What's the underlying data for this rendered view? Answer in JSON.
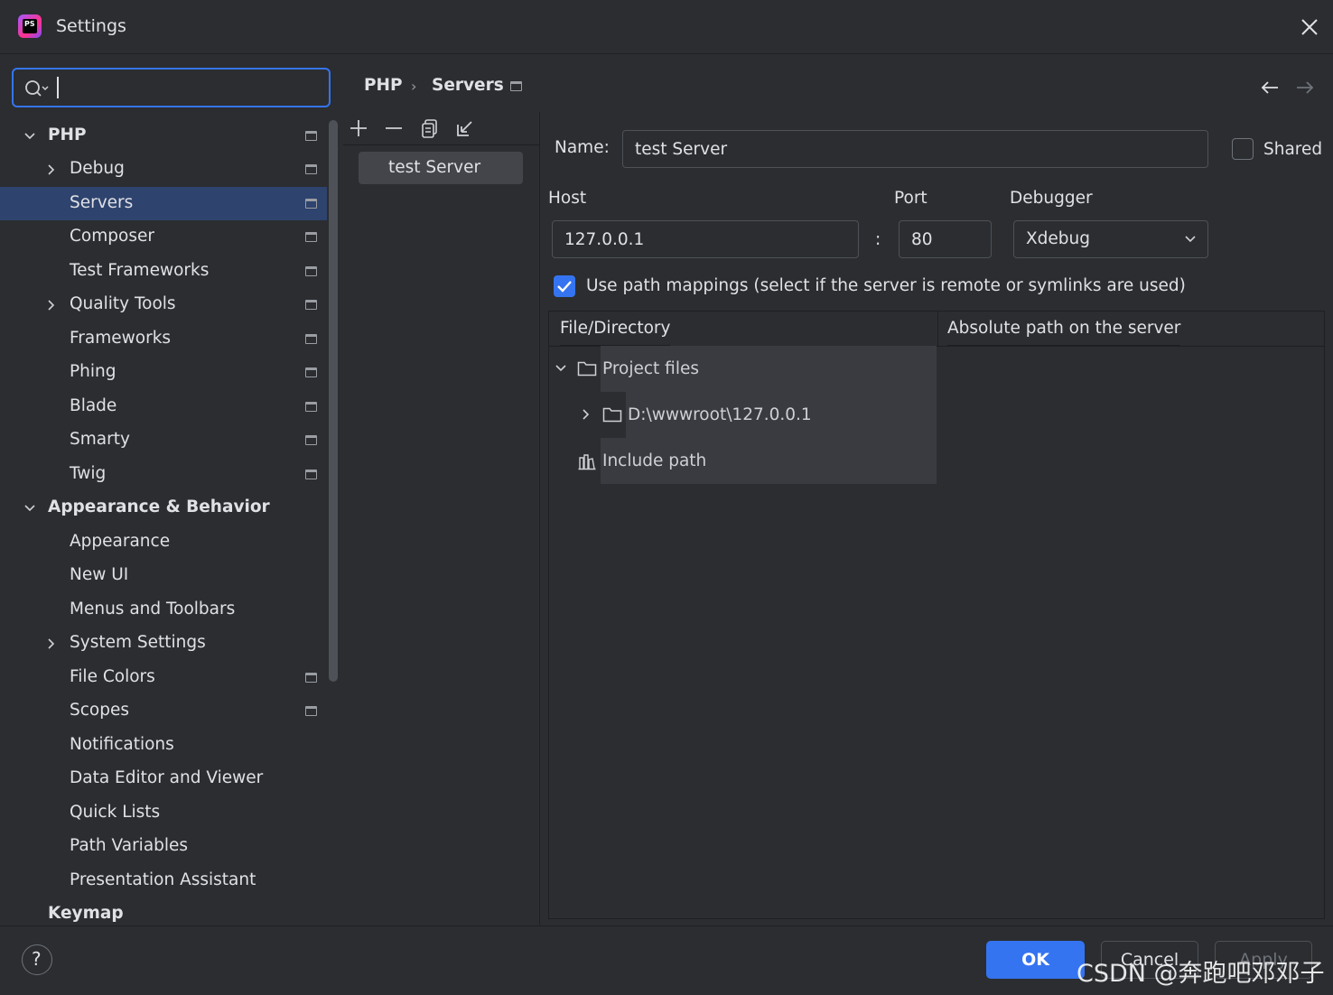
{
  "window": {
    "title": "Settings",
    "logo_text": "PS"
  },
  "search": {
    "value": "",
    "placeholder": ""
  },
  "breadcrumb": {
    "parent": "PHP",
    "separator": "›",
    "current": "Servers"
  },
  "sidebar": {
    "items": [
      {
        "label": "PHP",
        "bold": true
      },
      {
        "label": "Debug"
      },
      {
        "label": "Servers",
        "selected": true
      },
      {
        "label": "Composer"
      },
      {
        "label": "Test Frameworks"
      },
      {
        "label": "Quality Tools"
      },
      {
        "label": "Frameworks"
      },
      {
        "label": "Phing"
      },
      {
        "label": "Blade"
      },
      {
        "label": "Smarty"
      },
      {
        "label": "Twig"
      },
      {
        "label": "Appearance & Behavior",
        "bold": true
      },
      {
        "label": "Appearance"
      },
      {
        "label": "New UI"
      },
      {
        "label": "Menus and Toolbars"
      },
      {
        "label": "System Settings"
      },
      {
        "label": "File Colors"
      },
      {
        "label": "Scopes"
      },
      {
        "label": "Notifications"
      },
      {
        "label": "Data Editor and Viewer"
      },
      {
        "label": "Quick Lists"
      },
      {
        "label": "Path Variables"
      },
      {
        "label": "Presentation Assistant"
      },
      {
        "label": "Keymap",
        "bold": true
      }
    ]
  },
  "server_list": {
    "items": [
      "test Server"
    ]
  },
  "form": {
    "name_label": "Name:",
    "name_value": "test Server",
    "shared_label": "Shared",
    "host_label": "Host",
    "host_value": "127.0.0.1",
    "colon": ":",
    "port_label": "Port",
    "port_value": "80",
    "debugger_label": "Debugger",
    "debugger_value": "Xdebug",
    "path_mappings_label": "Use path mappings (select if the server is remote or symlinks are used)"
  },
  "mapping_table": {
    "columns": [
      "File/Directory",
      "Absolute path on the server"
    ],
    "rows": [
      {
        "label": "Project files",
        "icon": "folder-icon"
      },
      {
        "label": "D:\\wwwroot\\127.0.0.1",
        "icon": "folder-icon"
      },
      {
        "label": "Include path",
        "icon": "library-icon"
      }
    ]
  },
  "footer": {
    "help": "?",
    "ok": "OK",
    "cancel": "Cancel",
    "apply": "Apply"
  },
  "watermark": "CSDN @奔跑吧邓邓子",
  "colors": {
    "accent": "#3574f0",
    "selection": "#2e436e",
    "background": "#2b2d30"
  }
}
